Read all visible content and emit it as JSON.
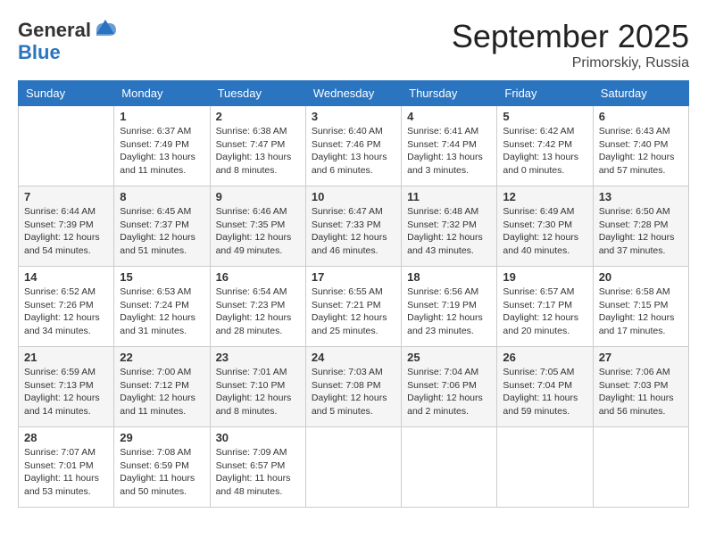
{
  "header": {
    "logo_general": "General",
    "logo_blue": "Blue",
    "title": "September 2025",
    "location": "Primorskiy, Russia"
  },
  "days_of_week": [
    "Sunday",
    "Monday",
    "Tuesday",
    "Wednesday",
    "Thursday",
    "Friday",
    "Saturday"
  ],
  "weeks": [
    [
      {
        "day": "",
        "info": ""
      },
      {
        "day": "1",
        "info": "Sunrise: 6:37 AM\nSunset: 7:49 PM\nDaylight: 13 hours\nand 11 minutes."
      },
      {
        "day": "2",
        "info": "Sunrise: 6:38 AM\nSunset: 7:47 PM\nDaylight: 13 hours\nand 8 minutes."
      },
      {
        "day": "3",
        "info": "Sunrise: 6:40 AM\nSunset: 7:46 PM\nDaylight: 13 hours\nand 6 minutes."
      },
      {
        "day": "4",
        "info": "Sunrise: 6:41 AM\nSunset: 7:44 PM\nDaylight: 13 hours\nand 3 minutes."
      },
      {
        "day": "5",
        "info": "Sunrise: 6:42 AM\nSunset: 7:42 PM\nDaylight: 13 hours\nand 0 minutes."
      },
      {
        "day": "6",
        "info": "Sunrise: 6:43 AM\nSunset: 7:40 PM\nDaylight: 12 hours\nand 57 minutes."
      }
    ],
    [
      {
        "day": "7",
        "info": "Sunrise: 6:44 AM\nSunset: 7:39 PM\nDaylight: 12 hours\nand 54 minutes."
      },
      {
        "day": "8",
        "info": "Sunrise: 6:45 AM\nSunset: 7:37 PM\nDaylight: 12 hours\nand 51 minutes."
      },
      {
        "day": "9",
        "info": "Sunrise: 6:46 AM\nSunset: 7:35 PM\nDaylight: 12 hours\nand 49 minutes."
      },
      {
        "day": "10",
        "info": "Sunrise: 6:47 AM\nSunset: 7:33 PM\nDaylight: 12 hours\nand 46 minutes."
      },
      {
        "day": "11",
        "info": "Sunrise: 6:48 AM\nSunset: 7:32 PM\nDaylight: 12 hours\nand 43 minutes."
      },
      {
        "day": "12",
        "info": "Sunrise: 6:49 AM\nSunset: 7:30 PM\nDaylight: 12 hours\nand 40 minutes."
      },
      {
        "day": "13",
        "info": "Sunrise: 6:50 AM\nSunset: 7:28 PM\nDaylight: 12 hours\nand 37 minutes."
      }
    ],
    [
      {
        "day": "14",
        "info": "Sunrise: 6:52 AM\nSunset: 7:26 PM\nDaylight: 12 hours\nand 34 minutes."
      },
      {
        "day": "15",
        "info": "Sunrise: 6:53 AM\nSunset: 7:24 PM\nDaylight: 12 hours\nand 31 minutes."
      },
      {
        "day": "16",
        "info": "Sunrise: 6:54 AM\nSunset: 7:23 PM\nDaylight: 12 hours\nand 28 minutes."
      },
      {
        "day": "17",
        "info": "Sunrise: 6:55 AM\nSunset: 7:21 PM\nDaylight: 12 hours\nand 25 minutes."
      },
      {
        "day": "18",
        "info": "Sunrise: 6:56 AM\nSunset: 7:19 PM\nDaylight: 12 hours\nand 23 minutes."
      },
      {
        "day": "19",
        "info": "Sunrise: 6:57 AM\nSunset: 7:17 PM\nDaylight: 12 hours\nand 20 minutes."
      },
      {
        "day": "20",
        "info": "Sunrise: 6:58 AM\nSunset: 7:15 PM\nDaylight: 12 hours\nand 17 minutes."
      }
    ],
    [
      {
        "day": "21",
        "info": "Sunrise: 6:59 AM\nSunset: 7:13 PM\nDaylight: 12 hours\nand 14 minutes."
      },
      {
        "day": "22",
        "info": "Sunrise: 7:00 AM\nSunset: 7:12 PM\nDaylight: 12 hours\nand 11 minutes."
      },
      {
        "day": "23",
        "info": "Sunrise: 7:01 AM\nSunset: 7:10 PM\nDaylight: 12 hours\nand 8 minutes."
      },
      {
        "day": "24",
        "info": "Sunrise: 7:03 AM\nSunset: 7:08 PM\nDaylight: 12 hours\nand 5 minutes."
      },
      {
        "day": "25",
        "info": "Sunrise: 7:04 AM\nSunset: 7:06 PM\nDaylight: 12 hours\nand 2 minutes."
      },
      {
        "day": "26",
        "info": "Sunrise: 7:05 AM\nSunset: 7:04 PM\nDaylight: 11 hours\nand 59 minutes."
      },
      {
        "day": "27",
        "info": "Sunrise: 7:06 AM\nSunset: 7:03 PM\nDaylight: 11 hours\nand 56 minutes."
      }
    ],
    [
      {
        "day": "28",
        "info": "Sunrise: 7:07 AM\nSunset: 7:01 PM\nDaylight: 11 hours\nand 53 minutes."
      },
      {
        "day": "29",
        "info": "Sunrise: 7:08 AM\nSunset: 6:59 PM\nDaylight: 11 hours\nand 50 minutes."
      },
      {
        "day": "30",
        "info": "Sunrise: 7:09 AM\nSunset: 6:57 PM\nDaylight: 11 hours\nand 48 minutes."
      },
      {
        "day": "",
        "info": ""
      },
      {
        "day": "",
        "info": ""
      },
      {
        "day": "",
        "info": ""
      },
      {
        "day": "",
        "info": ""
      }
    ]
  ]
}
